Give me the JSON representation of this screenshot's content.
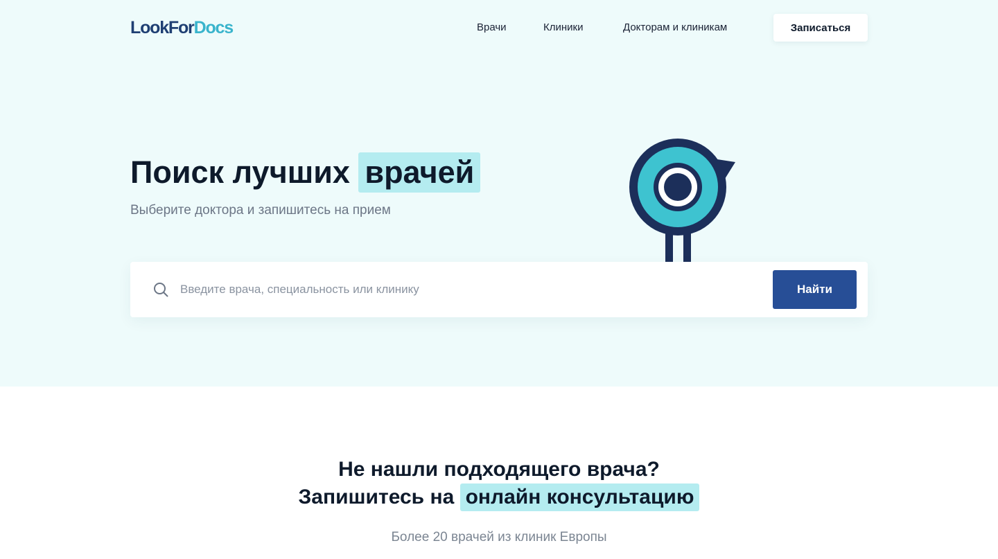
{
  "header": {
    "logo_dark": "LookFor",
    "logo_light": "Docs",
    "nav": [
      "Врачи",
      "Клиники",
      "Докторам и клиникам"
    ],
    "cta_label": "Записаться"
  },
  "hero": {
    "title_plain": "Поиск лучших",
    "title_highlight": "врачей",
    "subtitle": "Выберите доктора и запишитесь на прием"
  },
  "search": {
    "placeholder": "Введите врача, специальность или клинику",
    "value": "",
    "button_label": "Найти",
    "icon": "search-icon"
  },
  "consult": {
    "line1": "Не нашли подходящего врача?",
    "line2_plain": "Запишитесь на",
    "line2_highlight": "онлайн консультацию",
    "subtitle": "Более 20 врачей из клиник Европы"
  },
  "colors": {
    "hero_bg": "#eefbfb",
    "highlight": "#b4ecf0",
    "brand_dark": "#1f3f73",
    "brand_light": "#39b4cc",
    "button_primary": "#274e96"
  }
}
